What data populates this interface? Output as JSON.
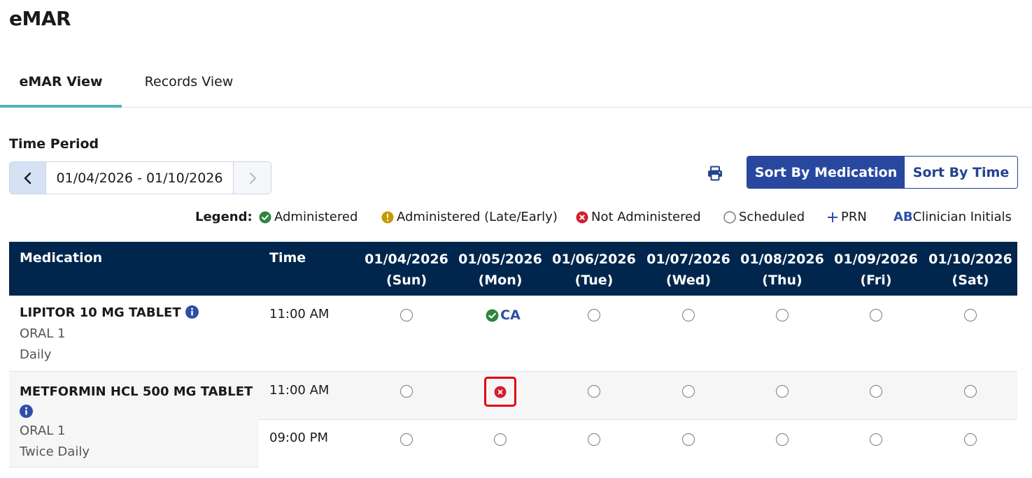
{
  "page": {
    "title": "eMAR"
  },
  "tabs": [
    {
      "label": "eMAR View",
      "active": true
    },
    {
      "label": "Records View",
      "active": false
    }
  ],
  "time_period": {
    "label": "Time Period",
    "range": "01/04/2026 - 01/10/2026"
  },
  "sort": {
    "by_medication": "Sort By Medication",
    "by_time": "Sort By Time",
    "active": "by_medication"
  },
  "legend": {
    "title": "Legend:",
    "administered": "Administered",
    "late_early": "Administered (Late/Early)",
    "not_administered": "Not Administered",
    "scheduled": "Scheduled",
    "prn": "PRN",
    "ab": "AB",
    "initials": "Clinician Initials"
  },
  "table": {
    "headers": {
      "medication": "Medication",
      "time": "Time"
    },
    "days": [
      {
        "date": "01/04/2026",
        "weekday": "(Sun)"
      },
      {
        "date": "01/05/2026",
        "weekday": "(Mon)"
      },
      {
        "date": "01/06/2026",
        "weekday": "(Tue)"
      },
      {
        "date": "01/07/2026",
        "weekday": "(Wed)"
      },
      {
        "date": "01/08/2026",
        "weekday": "(Thu)"
      },
      {
        "date": "01/09/2026",
        "weekday": "(Fri)"
      },
      {
        "date": "01/10/2026",
        "weekday": "(Sat)"
      }
    ],
    "rows": [
      {
        "name": "LIPITOR 10 MG TABLET",
        "route": "ORAL 1",
        "frequency": "Daily",
        "times": [
          {
            "time": "11:00 AM",
            "statuses": [
              "scheduled",
              "administered",
              "scheduled",
              "scheduled",
              "scheduled",
              "scheduled",
              "scheduled"
            ],
            "initials": "CA"
          }
        ]
      },
      {
        "name": "METFORMIN HCL 500 MG TABLET",
        "route": "ORAL 1",
        "frequency": "Twice Daily",
        "times": [
          {
            "time": "11:00 AM",
            "statuses": [
              "scheduled",
              "not_administered",
              "scheduled",
              "scheduled",
              "scheduled",
              "scheduled",
              "scheduled"
            ]
          },
          {
            "time": "09:00 PM",
            "statuses": [
              "scheduled",
              "scheduled",
              "scheduled",
              "scheduled",
              "scheduled",
              "scheduled",
              "scheduled"
            ]
          }
        ]
      }
    ]
  },
  "colors": {
    "header_bg": "#00264d",
    "accent_teal": "#4ab5b0",
    "primary_blue": "#2848a0",
    "administered_green": "#2e8540",
    "late_gold": "#c79a00",
    "not_administered_red": "#d0202e"
  }
}
